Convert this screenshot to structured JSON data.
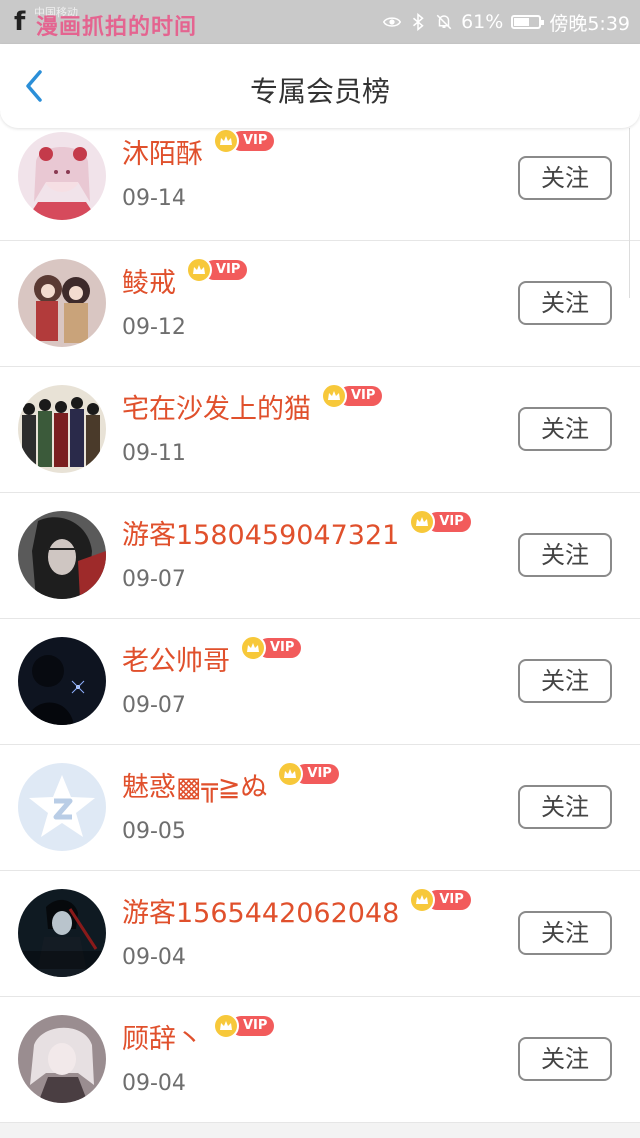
{
  "status_bar": {
    "carrier": "中国移动",
    "watermark": "漫画抓拍的时间",
    "battery": "61%",
    "battery_level": 0.61,
    "time": "傍晚5:39",
    "icons": [
      "eye-icon",
      "bluetooth-icon",
      "mute-icon",
      "battery-icon"
    ]
  },
  "header": {
    "title": "专属会员榜",
    "back_icon": "chevron-left-icon"
  },
  "vip_badge": "VIP",
  "follow_label": "关注",
  "colors": {
    "accent": "#e0502c",
    "back": "#2b8fd8",
    "vip": "#f25b5b",
    "crown": "#f7c83a"
  },
  "members": [
    {
      "name": "沐陌酥",
      "date": "09-14"
    },
    {
      "name": "鲮戒",
      "date": "09-12"
    },
    {
      "name": "宅在沙发上的猫",
      "date": "09-11"
    },
    {
      "name": "游客1580459047321",
      "date": "09-07"
    },
    {
      "name": "老公帅哥",
      "date": "09-07"
    },
    {
      "name": "魅惑▩╦≧ぬ",
      "date": "09-05"
    },
    {
      "name": "游客1565442062048",
      "date": "09-04"
    },
    {
      "name": "顾辞丶",
      "date": "09-04"
    }
  ]
}
